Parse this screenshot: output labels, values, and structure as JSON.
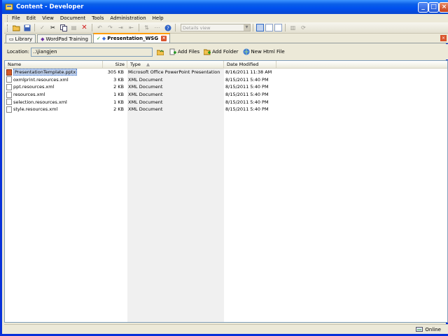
{
  "window": {
    "title": "Content - Developer"
  },
  "menu": [
    "File",
    "Edit",
    "View",
    "Document",
    "Tools",
    "Administration",
    "Help"
  ],
  "toolbar": {
    "view_select": "Details view"
  },
  "tabs": [
    {
      "label": "Library"
    },
    {
      "label": "WordPad Training"
    },
    {
      "label": "Presentation_WSG"
    }
  ],
  "location": {
    "label": "Location:",
    "value": "..\\jiangjen"
  },
  "actions": {
    "add_files": "Add Files",
    "add_folder": "Add Folder",
    "new_html": "New Html File"
  },
  "columns": {
    "name": "Name",
    "size": "Size",
    "type": "Type",
    "date": "Date Modified"
  },
  "files": [
    {
      "name": "PresentationTemplate.pptx",
      "size": "305 KB",
      "type": "Microsoft Office PowerPoint Presentation",
      "date": "8/16/2011 11:38 AM"
    },
    {
      "name": "oxmlprint.resources.xml",
      "size": "3 KB",
      "type": "XML Document",
      "date": "8/15/2011 5:40 PM"
    },
    {
      "name": "ppt.resources.xml",
      "size": "2 KB",
      "type": "XML Document",
      "date": "8/15/2011 5:40 PM"
    },
    {
      "name": "resources.xml",
      "size": "1 KB",
      "type": "XML Document",
      "date": "8/15/2011 5:40 PM"
    },
    {
      "name": "selection.resources.xml",
      "size": "1 KB",
      "type": "XML Document",
      "date": "8/15/2011 5:40 PM"
    },
    {
      "name": "style.resources.xml",
      "size": "2 KB",
      "type": "XML Document",
      "date": "8/15/2011 5:40 PM"
    }
  ],
  "status": {
    "text": "Online"
  }
}
